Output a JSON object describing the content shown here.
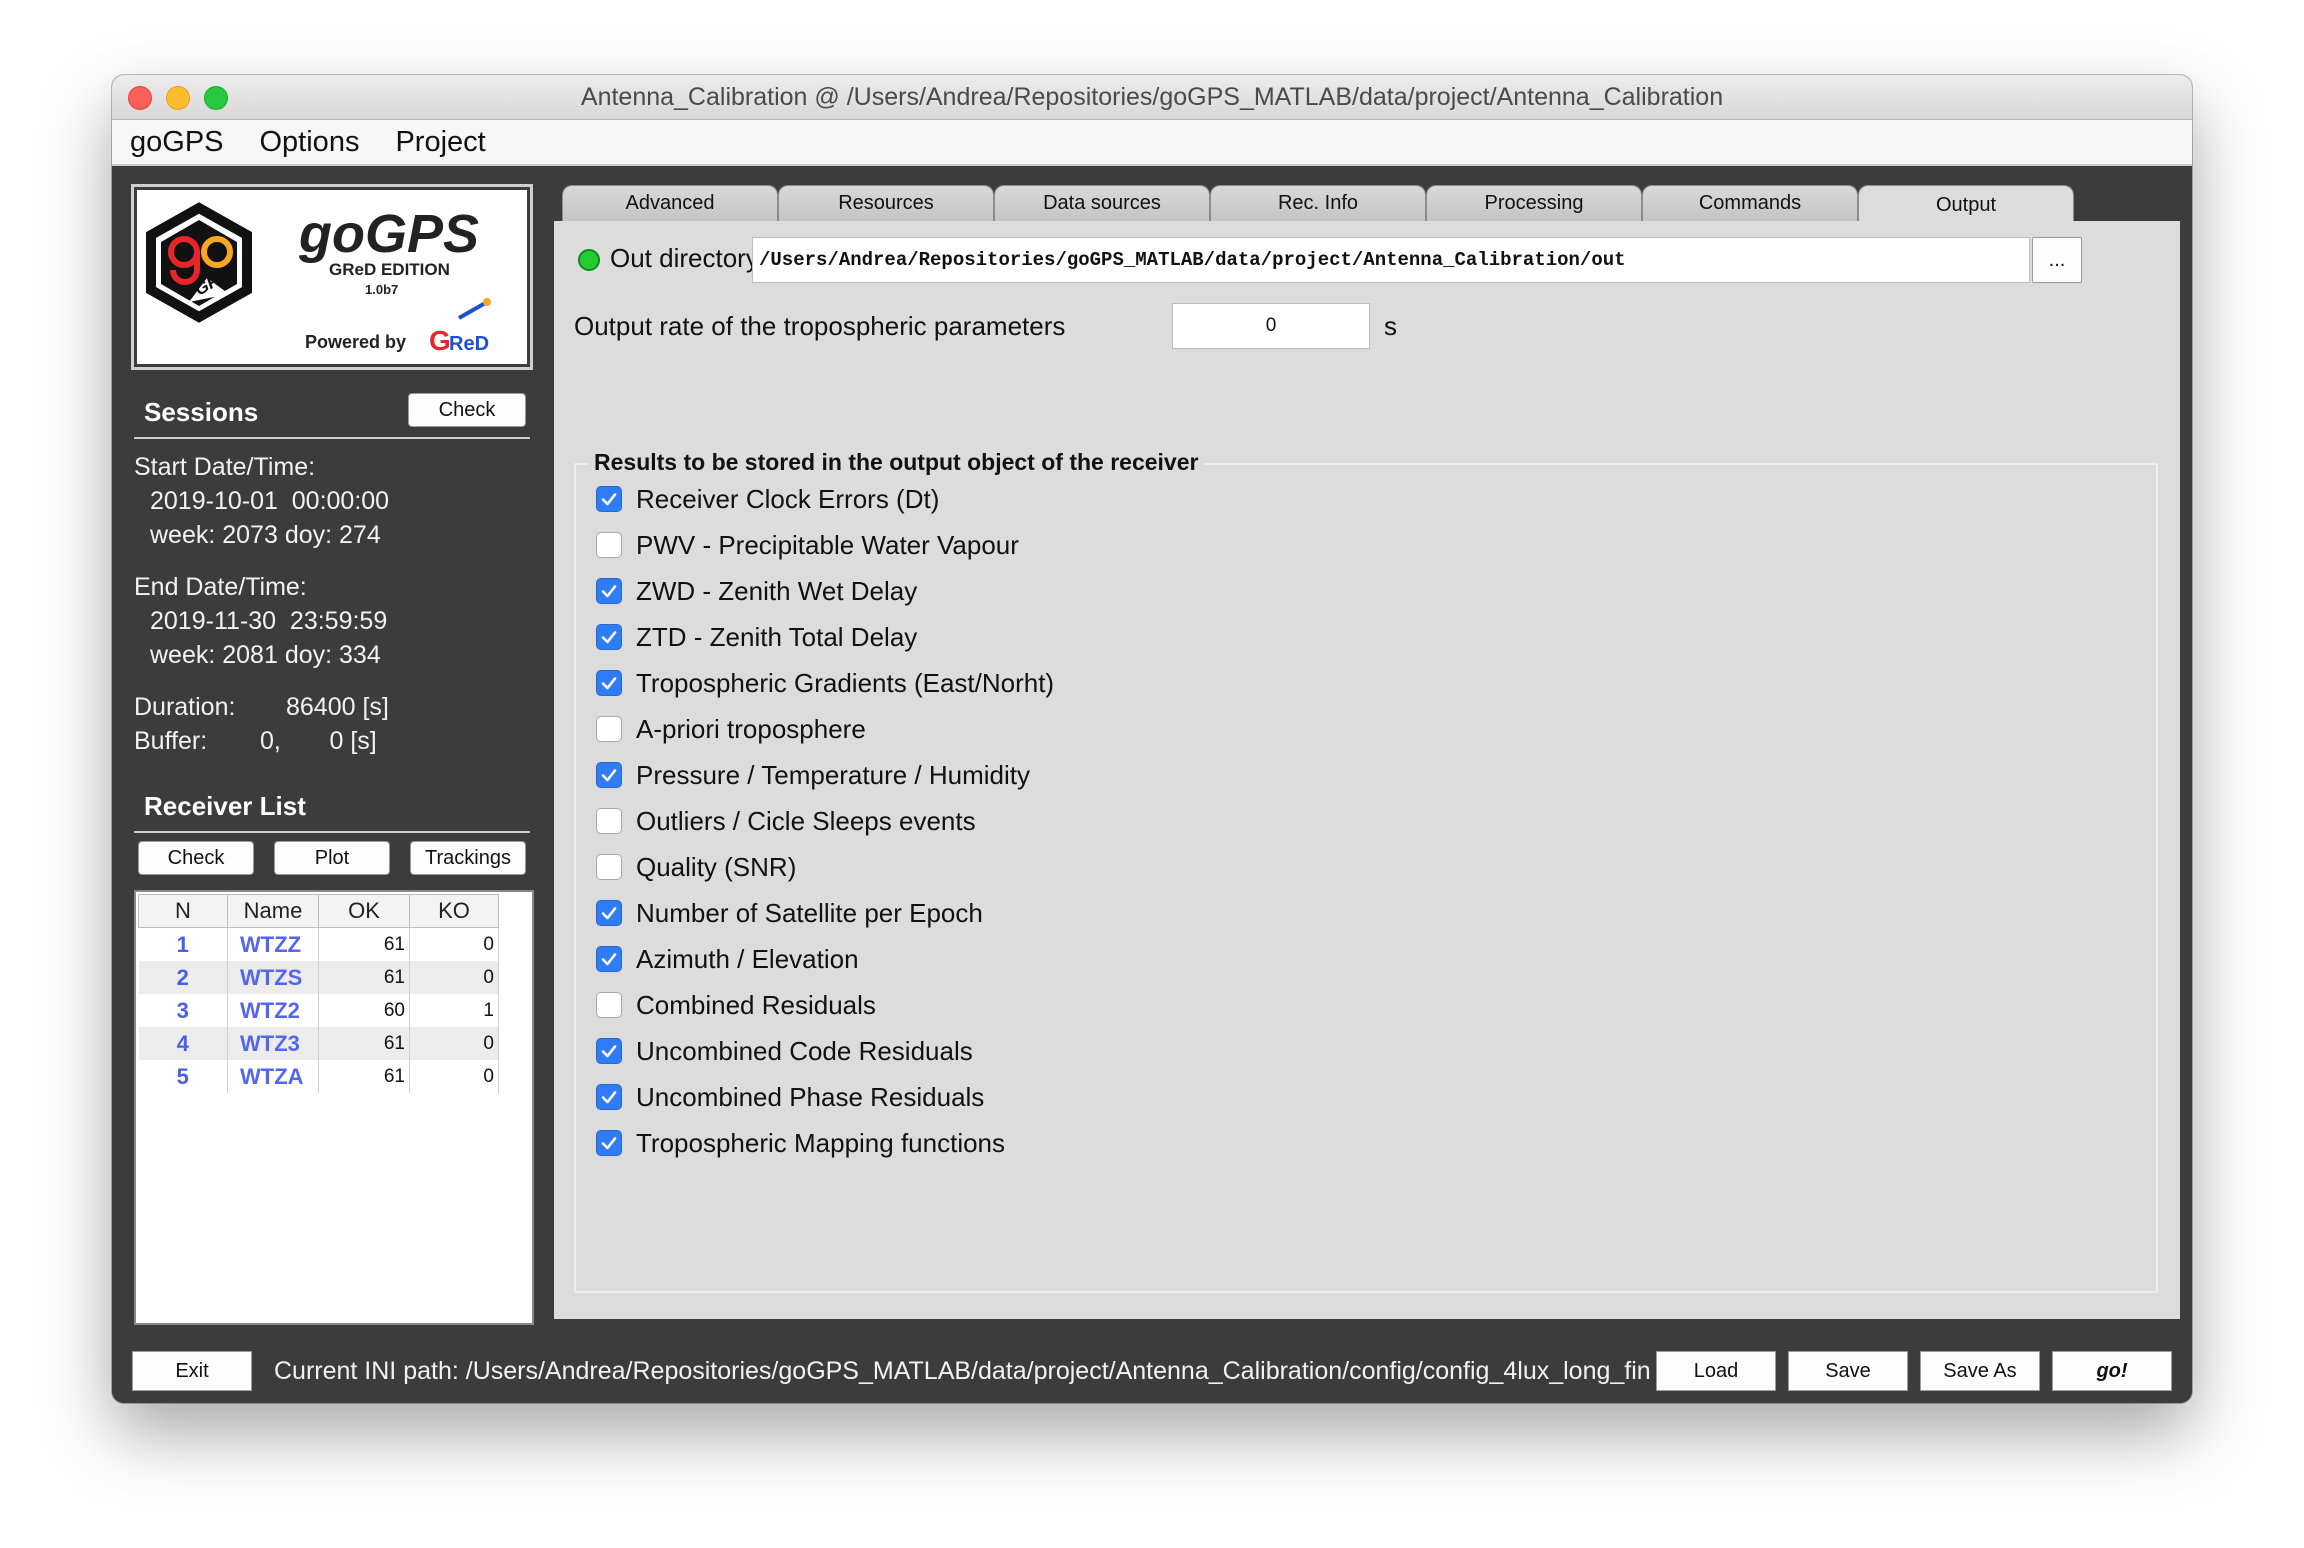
{
  "window": {
    "title": "Antenna_Calibration @ /Users/Andrea/Repositories/goGPS_MATLAB/data/project/Antenna_Calibration"
  },
  "menu": [
    "goGPS",
    "Options",
    "Project"
  ],
  "logo": {
    "name": "goGPS",
    "edition": "GReD EDITION",
    "version": "1.0b7",
    "powered_by": "Powered by",
    "brand": "GReD",
    "badge": "GPS"
  },
  "sessions": {
    "title": "Sessions",
    "check_label": "Check",
    "start_label": "Start Date/Time:",
    "start_datetime": "2019-10-01  00:00:00",
    "start_week": "week: 2073 doy: 274",
    "end_label": "End Date/Time:",
    "end_datetime": "2019-11-30  23:59:59",
    "end_week": "week: 2081 doy: 334",
    "duration_label": "Duration:",
    "duration_value": "86400 [s]",
    "buffer_label": "Buffer:",
    "buffer_value": "0,       0 [s]"
  },
  "receivers": {
    "title": "Receiver List",
    "buttons": [
      "Check",
      "Plot",
      "Trackings"
    ],
    "columns": [
      "N",
      "Name",
      "OK",
      "KO"
    ],
    "rows": [
      {
        "n": "1",
        "name": "WTZZ",
        "ok": "61",
        "ko": "0"
      },
      {
        "n": "2",
        "name": "WTZS",
        "ok": "61",
        "ko": "0"
      },
      {
        "n": "3",
        "name": "WTZ2",
        "ok": "60",
        "ko": "1"
      },
      {
        "n": "4",
        "name": "WTZ3",
        "ok": "61",
        "ko": "0"
      },
      {
        "n": "5",
        "name": "WTZA",
        "ok": "61",
        "ko": "0"
      }
    ]
  },
  "tabs": [
    "Advanced",
    "Resources",
    "Data sources",
    "Rec. Info",
    "Processing",
    "Commands",
    "Output"
  ],
  "active_tab": "Output",
  "output": {
    "out_dir_label": "Out directory",
    "out_dir_value": "/Users/Andrea/Repositories/goGPS_MATLAB/data/project/Antenna_Calibration/out",
    "browse_label": "...",
    "rate_label": "Output rate of the tropospheric parameters",
    "rate_value": "0",
    "rate_unit": "s",
    "group_title": "Results to be stored in the output object of the receiver",
    "options": [
      {
        "label": "Receiver Clock Errors (Dt)",
        "checked": true
      },
      {
        "label": "PWV - Precipitable Water Vapour",
        "checked": false
      },
      {
        "label": "ZWD - Zenith Wet Delay",
        "checked": true
      },
      {
        "label": "ZTD - Zenith Total Delay",
        "checked": true
      },
      {
        "label": "Tropospheric Gradients (East/Norht)",
        "checked": true
      },
      {
        "label": "A-priori troposphere",
        "checked": false
      },
      {
        "label": "Pressure / Temperature / Humidity",
        "checked": true
      },
      {
        "label": "Outliers / Cicle Sleeps events",
        "checked": false
      },
      {
        "label": "Quality (SNR)",
        "checked": false
      },
      {
        "label": "Number of Satellite per Epoch",
        "checked": true
      },
      {
        "label": "Azimuth / Elevation",
        "checked": true
      },
      {
        "label": "Combined Residuals",
        "checked": false
      },
      {
        "label": "Uncombined Code Residuals",
        "checked": true
      },
      {
        "label": "Uncombined Phase Residuals",
        "checked": true
      },
      {
        "label": "Tropospheric Mapping functions",
        "checked": true
      }
    ]
  },
  "bottom": {
    "exit_label": "Exit",
    "ini_label": "Current INI path:  /Users/Andrea/Repositories/goGPS_MATLAB/data/project/Antenna_Calibration/config/config_4lux_long_fin",
    "load_label": "Load",
    "save_label": "Save",
    "save_as_label": "Save As",
    "go_label": "go!"
  },
  "colors": {
    "led": "#22cc33",
    "checkbox_on": "#2f7df6",
    "receiver_link": "#5566ee",
    "panel_bg": "#3c3c3c"
  }
}
